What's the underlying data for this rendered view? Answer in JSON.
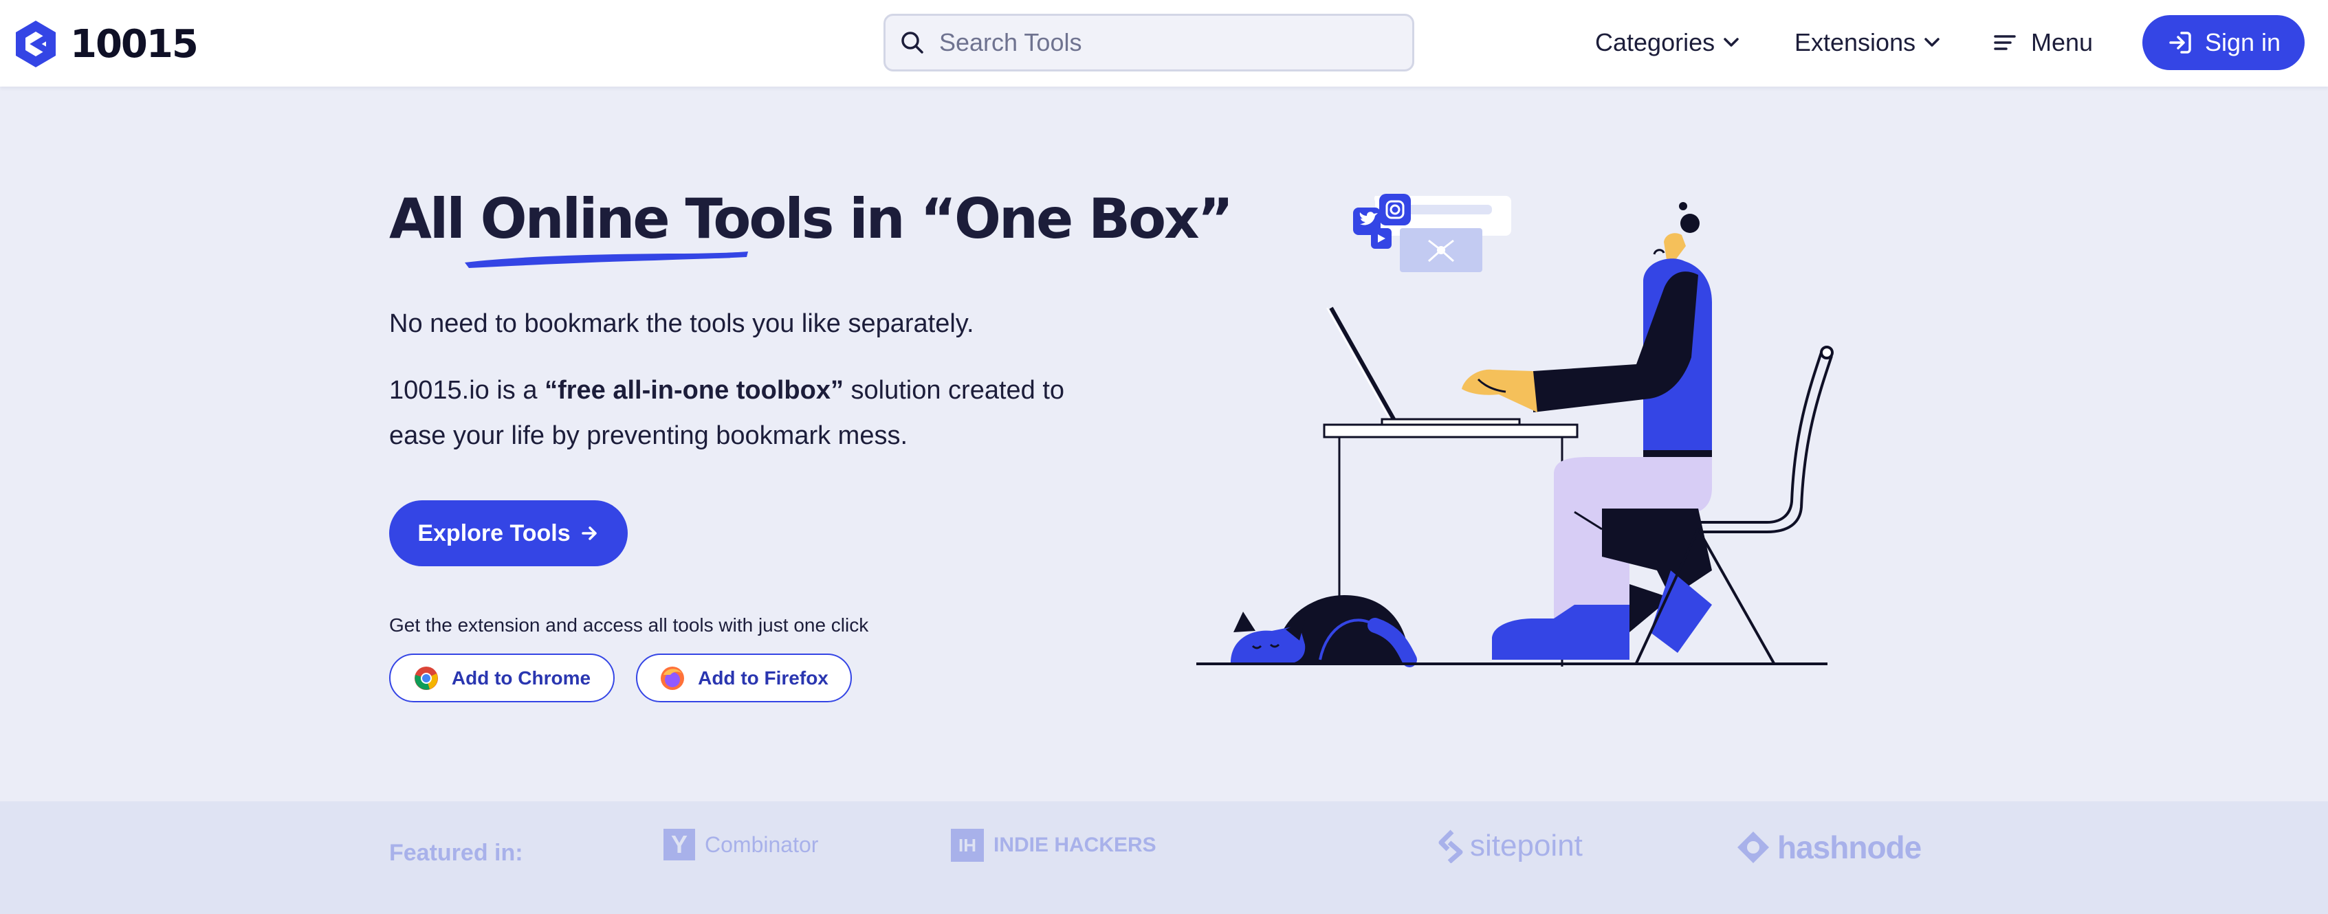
{
  "header": {
    "logo_text": "10015",
    "search_placeholder": "Search Tools",
    "nav": {
      "categories": "Categories",
      "extensions": "Extensions",
      "menu": "Menu"
    },
    "signin_label": "Sign in"
  },
  "hero": {
    "title_part1": "All ",
    "title_highlight": "Online Tools",
    "title_part2": " in “One Box”",
    "para1": "No need to bookmark the tools you like separately.",
    "para2_before": "10015.io is a ",
    "para2_bold": "“free all-in-one toolbox”",
    "para2_after": " solution created to ease your life by preventing bookmark mess.",
    "explore_label": "Explore Tools",
    "extension_note": "Get the extension and access all tools with just one click",
    "chrome_label": "Add to Chrome",
    "firefox_label": "Add to Firefox"
  },
  "featured": {
    "label": "Featured in:",
    "logos": {
      "ycombinator_mark": "Y",
      "ycombinator": "Combinator",
      "indiehackers_mark": "IH",
      "indiehackers": "INDIE HACKERS",
      "sitepoint": "sitepoint",
      "hashnode": "hashnode"
    }
  },
  "colors": {
    "accent": "#3445e5",
    "background": "#ebedf7",
    "text": "#1c1d3a",
    "featured_bg": "#dfe3f3",
    "featured_logo": "#a8b1ea"
  },
  "icons": [
    "hexagon-logo-icon",
    "search-icon",
    "chevron-down-icon",
    "menu-icon",
    "signin-icon",
    "arrow-right-icon",
    "chrome-icon",
    "firefox-icon"
  ]
}
